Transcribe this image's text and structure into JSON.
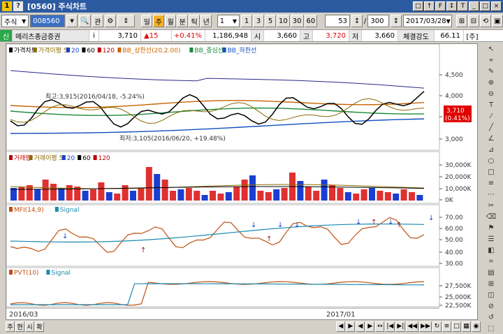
{
  "window": {
    "title": "[0560] 주식차트",
    "icon1": "1",
    "icon2": "?",
    "controls": [
      "□",
      "↑",
      "F",
      "↕",
      "T",
      "_",
      "□",
      "×"
    ]
  },
  "toolbar": {
    "market": "주식",
    "code": "008560",
    "period_buttons": [
      "일",
      "주",
      "월",
      "분",
      "틱",
      "년"
    ],
    "period_active": "주",
    "interval": "1",
    "interval_buttons": [
      "1",
      "3",
      "5",
      "10",
      "30",
      "60"
    ],
    "count": "53",
    "total": "300",
    "date": "2017/03/28"
  },
  "info": {
    "badge": "신",
    "name": "메리츠종금증권",
    "price": "3,710",
    "change": "15",
    "change_pct": "+0.41%",
    "volume": "1,186,948",
    "open_label": "시",
    "open": "3,660",
    "high_label": "고",
    "high": "3,720",
    "low_label": "저",
    "low": "3,660",
    "strength_label": "체결강도",
    "strength": "66.11",
    "unit": "[주]"
  },
  "price_panel": {
    "legend": [
      "가격차트",
      "가격이평 5",
      "20",
      "60",
      "120",
      "BB_상한선(20,2.00)",
      "BB_중심선",
      "BB_하한선"
    ],
    "y_ticks": [
      "4,500",
      "4,000",
      "3,500",
      "3,000"
    ],
    "high_annotation": "최고:3,915(2016/04/18, -5.24%)",
    "low_annotation": "최저:3,105(2016/06/20, +19.48%)",
    "current_price": "3,710",
    "current_pct": "(0.41%)"
  },
  "volume_panel": {
    "legend": [
      "거래량",
      "거래이평 5",
      "20",
      "60",
      "120"
    ],
    "y_ticks": [
      "30,000K",
      "20,000K",
      "10,000K",
      "0K"
    ]
  },
  "mfi_panel": {
    "legend": [
      "MFI(14,9)",
      "Signal"
    ],
    "y_ticks": [
      "70.00",
      "60.00",
      "50.00",
      "40.00",
      "30.00"
    ]
  },
  "pvt_panel": {
    "legend": [
      "PVT(10)",
      "Signal"
    ],
    "y_ticks": [
      "27,500K",
      "25,000K",
      "22,500K"
    ]
  },
  "x_axis": {
    "labels": [
      "2016/03",
      "2017/01"
    ]
  },
  "bottom": {
    "buttons": [
      "주",
      "현",
      "시",
      "확"
    ],
    "right_buttons": [
      "◀",
      "▶",
      "◀",
      "▶",
      "↔",
      "|◀",
      "▶|",
      "◀◀",
      "▶▶",
      "↻",
      "≡",
      "□",
      "▦",
      "◉"
    ]
  },
  "colors": {
    "title_bg": "#2b5aa0",
    "up": "#e00000",
    "down": "#1a3fd0",
    "upper_band": "#c86400",
    "middle_band": "#1a8a3a",
    "lower_band": "#1050c0"
  }
}
